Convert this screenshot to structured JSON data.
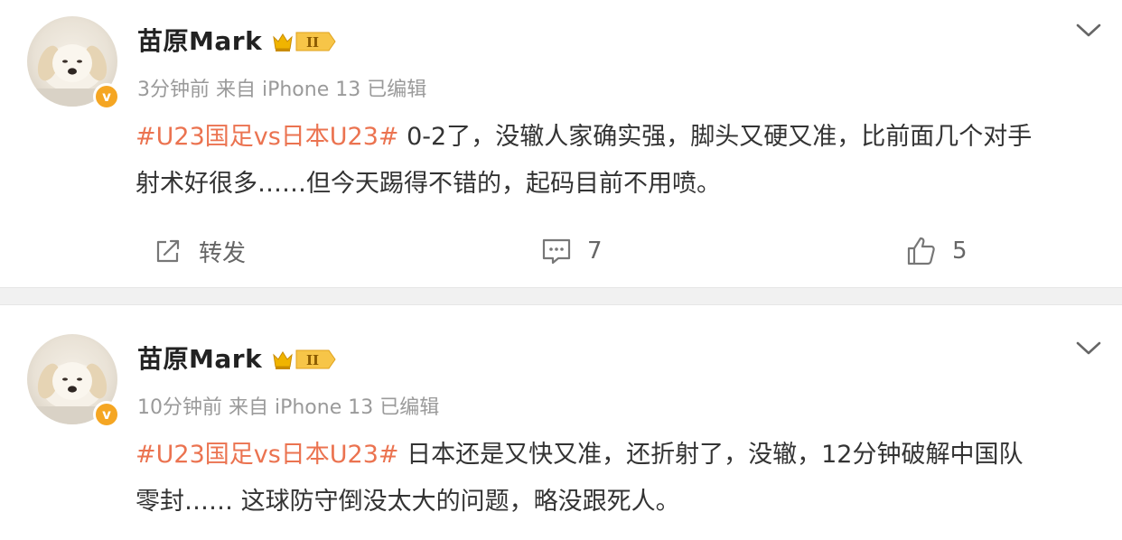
{
  "posts": [
    {
      "author": "苗原Mark",
      "level_badge": "II",
      "verified_badge": "v",
      "meta": "3分钟前 来自 iPhone 13 已编辑",
      "hashtag": "#U23国足vs日本U23#",
      "text_line1": " 0-2了，没辙人家确实强，脚头又硬又准，比前面几个对手",
      "text_line2": "射术好很多……但今天踢得不错的，起码目前不用喷。",
      "actions": {
        "repost_label": "转发",
        "comment_count": "7",
        "like_count": "5"
      }
    },
    {
      "author": "苗原Mark",
      "level_badge": "II",
      "verified_badge": "v",
      "meta": "10分钟前 来自 iPhone 13 已编辑",
      "hashtag": "#U23国足vs日本U23#",
      "text_line1": " 日本还是又快又准，还折射了，没辙，12分钟破解中国队",
      "text_line2": "零封…… 这球防守倒没太大的问题，略没跟死人。"
    }
  ],
  "colors": {
    "hashtag": "#eb7350",
    "name": "#222222",
    "meta": "#9a9a9a",
    "badge_orange": "#f5a623",
    "separator": "#f1f1f1"
  },
  "icons": [
    "chevron-down-icon",
    "repost-icon",
    "comment-icon",
    "like-icon",
    "crown-level-icon",
    "verified-icon"
  ]
}
